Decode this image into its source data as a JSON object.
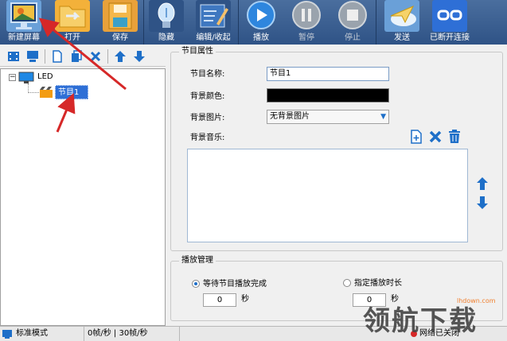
{
  "toolbar": {
    "new_screen": "新建屏幕",
    "open": "打开",
    "save": "保存",
    "hide": "隐藏",
    "edit_collapse": "编辑/收起",
    "play": "播放",
    "pause": "暂停",
    "stop": "停止",
    "send": "发送",
    "disconnect": "已断开连接"
  },
  "tree": {
    "root": "LED",
    "program": "节目1"
  },
  "program_props": {
    "title": "节目属性",
    "name_label": "节目名称:",
    "name_value": "节目1",
    "bgcolor_label": "背景颜色:",
    "bgimage_label": "背景图片:",
    "bgimage_value": "无背景图片",
    "bgmusic_label": "背景音乐:"
  },
  "playback": {
    "title": "播放管理",
    "wait_option": "等待节目播放完成",
    "wait_seconds": "0",
    "specify_option": "指定播放时长",
    "specify_seconds": "0",
    "unit": "秒"
  },
  "status": {
    "mode": "标准模式",
    "fps": "0帧/秒 | 30帧/秒",
    "network": "网络已关闭"
  },
  "watermark": {
    "site": "lhdown.com",
    "brand": "领航下载"
  },
  "colors": {
    "toolbar": "#3a5f91",
    "selection": "#2e6fd6",
    "accent_blue": "#1e6fc8",
    "arrow_red": "#d62828",
    "bg_color_swatch": "#000000"
  }
}
